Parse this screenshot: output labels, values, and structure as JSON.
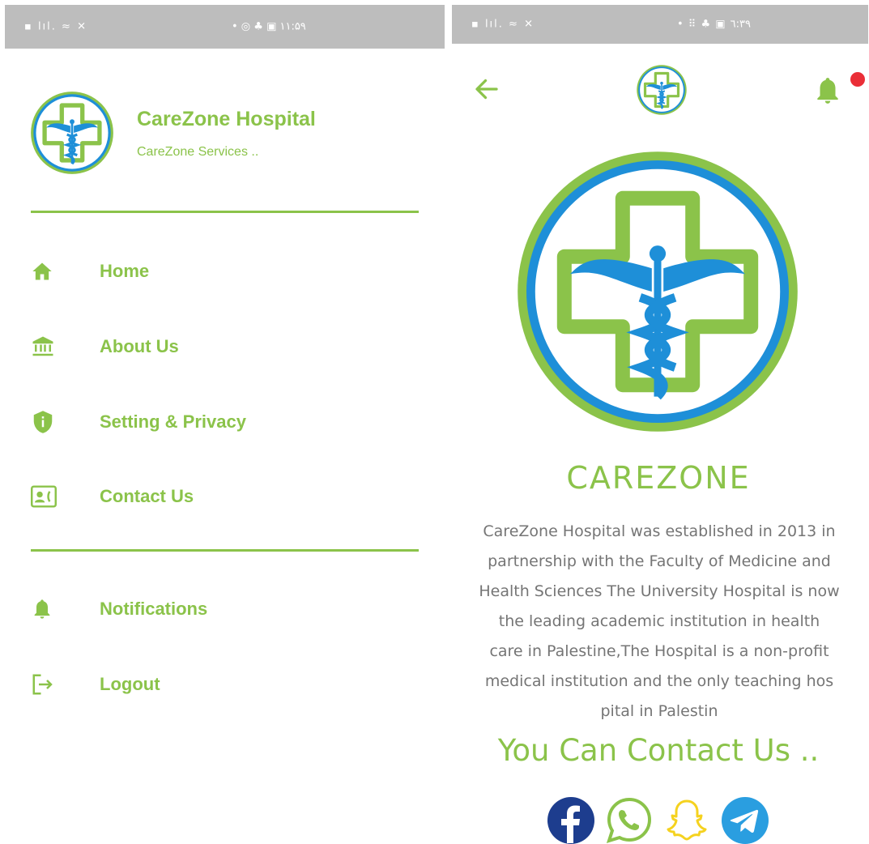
{
  "left_status": {
    "left_icons": "▪ lıl. ≈ ✕",
    "right_icons": "• ◎ ♣ ▣ ۱۱:۵۹"
  },
  "right_status": {
    "left_icons": "▪ lıl. ≈ ✕",
    "right_icons": "• ⠿ ♣ ▣ ٦:٣٩"
  },
  "drawer": {
    "app_name": "CareZone Hospital",
    "app_subtitle": "CareZone Services ..",
    "menu": [
      {
        "label": "Home",
        "icon": "home-icon"
      },
      {
        "label": "About Us",
        "icon": "bank-icon"
      },
      {
        "label": "Setting & Privacy",
        "icon": "shield-icon"
      },
      {
        "label": "Contact Us",
        "icon": "contact-card-icon"
      }
    ],
    "menu2": [
      {
        "label": "Notifications",
        "icon": "bell-icon"
      },
      {
        "label": "Logout",
        "icon": "logout-icon"
      }
    ]
  },
  "about": {
    "brand": "CAREZONE",
    "lines": [
      "CareZone Hospital was established in 2013 in",
      "partnership with the Faculty of Medicine and",
      "Health Sciences  The University Hospital is now",
      "the leading academic institution in health",
      "care in Palestine,The Hospital is a non-profit",
      "medical institution and the only teaching hos",
      "pital in Palestin"
    ],
    "contact_title": "You Can Contact Us ..",
    "socials": [
      "facebook-icon",
      "whatsapp-icon",
      "snapchat-icon",
      "telegram-icon"
    ]
  },
  "colors": {
    "accent": "#8bc34a",
    "logo_blue": "#1e8fd8",
    "text_grey": "#757575",
    "badge_red": "#ea2e37"
  }
}
